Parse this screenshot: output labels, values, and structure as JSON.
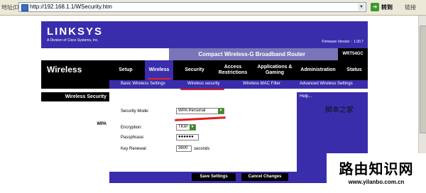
{
  "browser": {
    "address_label": "地址(D)",
    "url": "http://192.168.1.1/WSecurity.htm",
    "go_label": "转到",
    "links_label": "链接"
  },
  "router": {
    "logo": "LINKSYS",
    "logo_sub": "A Division of Cisco Systems, Inc.",
    "firmware_label": "Firmware Version :",
    "firmware_version": "1.00.7",
    "product_name": "Compact Wireless-G Broadband Router",
    "model": "WRT54GC",
    "section_title": "Wireless",
    "tabs": [
      {
        "label": "Setup"
      },
      {
        "label": "Wireless"
      },
      {
        "label": "Security"
      },
      {
        "label": "Access Restrictions"
      },
      {
        "label": "Applications & Gaming"
      },
      {
        "label": "Administration"
      },
      {
        "label": "Status"
      }
    ],
    "subtabs": [
      {
        "label": "Basic Wireless Settings"
      },
      {
        "label": "Wireless security"
      },
      {
        "label": "Wireless MAC Filter"
      },
      {
        "label": "Advanced Wireless Settings"
      }
    ],
    "left_heading": "Wireless Security",
    "left_sub": "WPA",
    "form": {
      "security_mode_label": "Security Mode:",
      "security_mode_value": "WPA Personal",
      "encryption_label": "Encryption:",
      "encryption_value": "TKIP",
      "passphrase_label": "Passphrase:",
      "passphrase_value": "●●●●●●",
      "key_renewal_label": "Key Renewal:",
      "key_renewal_value": "3600",
      "key_renewal_unit": "seconds"
    },
    "help_title": "Help...",
    "help_watermark": "脚本之家",
    "save_label": "Save Settings",
    "cancel_label": "Cancel Changes"
  },
  "watermark": {
    "title": "路由知识网",
    "url": "www.yilanbo.com.cn"
  }
}
